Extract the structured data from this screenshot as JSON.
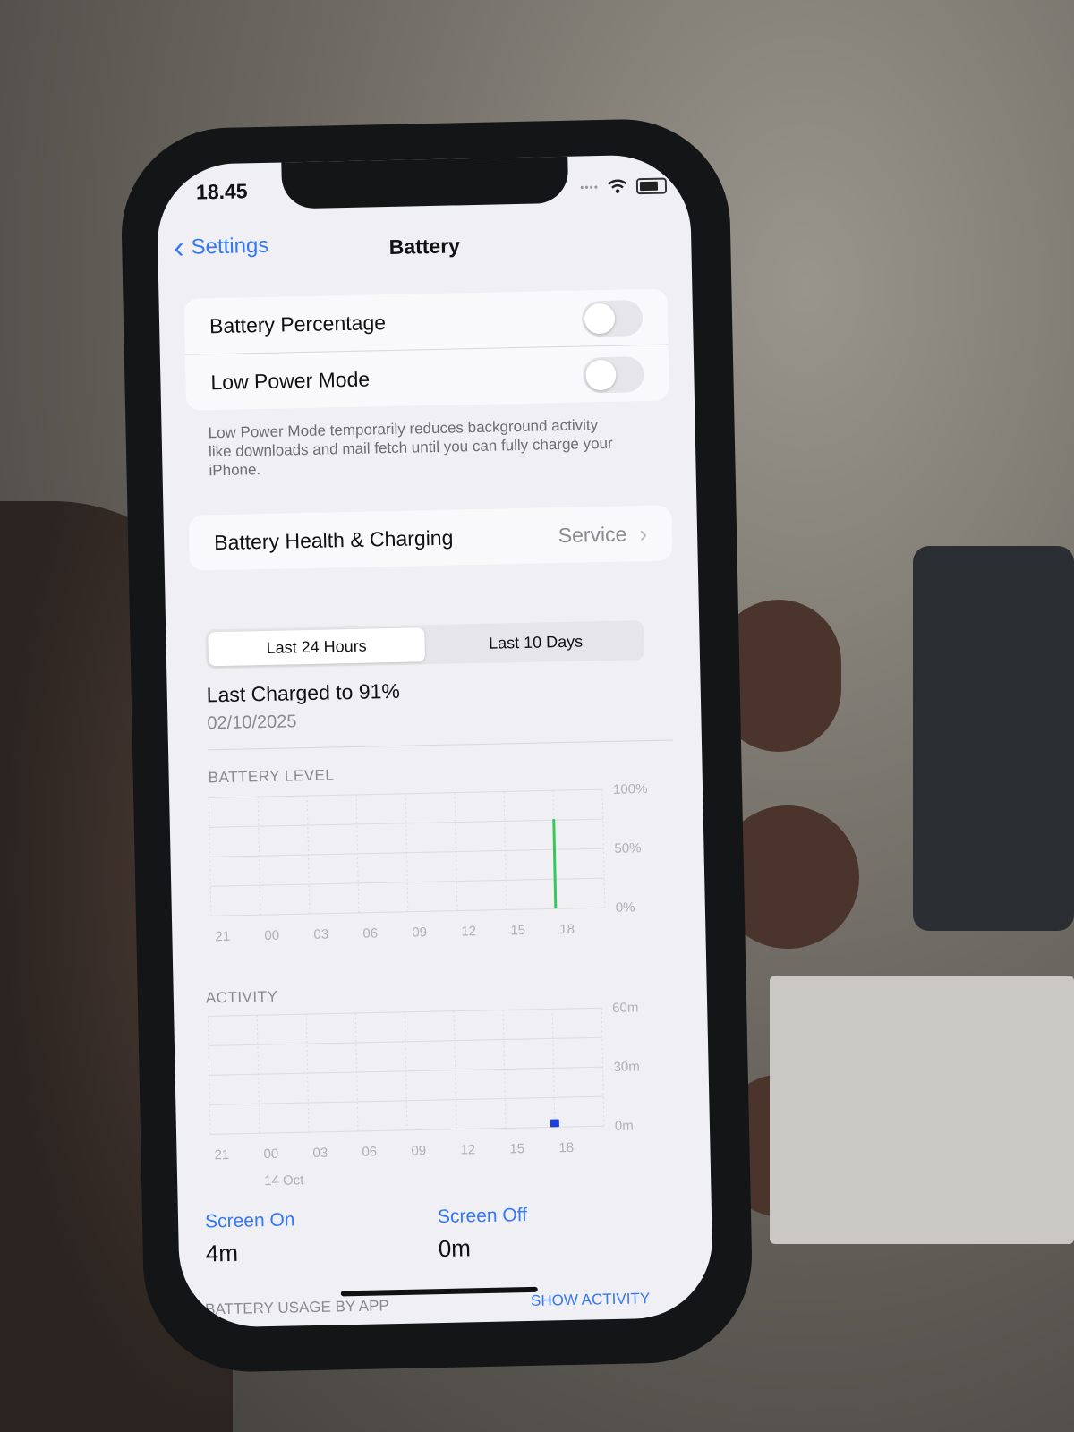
{
  "status_bar": {
    "time": "18.45"
  },
  "nav": {
    "back_label": "Settings",
    "title": "Battery"
  },
  "toggles": {
    "battery_percentage": {
      "label": "Battery Percentage",
      "on": false
    },
    "low_power_mode": {
      "label": "Low Power Mode",
      "on": false
    }
  },
  "low_power_note": "Low Power Mode temporarily reduces background activity like downloads and mail fetch until you can fully charge your iPhone.",
  "health": {
    "label": "Battery Health & Charging",
    "value": "Service"
  },
  "segments": {
    "tab_24h": "Last 24 Hours",
    "tab_10d": "Last 10 Days",
    "selected": "Last 10 Days"
  },
  "last_charged": {
    "title": "Last Charged to 91%",
    "date": "02/10/2025"
  },
  "battery_level_label": "BATTERY LEVEL",
  "activity_label": "ACTIVITY",
  "date_marker": "14 Oct",
  "chart_data": [
    {
      "type": "bar",
      "title": "BATTERY LEVEL",
      "categories": [
        "21",
        "00",
        "03",
        "06",
        "09",
        "12",
        "15",
        "18"
      ],
      "y_ticks": [
        "100%",
        "50%",
        "0%"
      ],
      "ylim": [
        0,
        100
      ],
      "bars": [
        {
          "x_hour": 18,
          "value": 76,
          "color": "#34c759"
        }
      ],
      "grid": true
    },
    {
      "type": "bar",
      "title": "ACTIVITY",
      "categories": [
        "21",
        "00",
        "03",
        "06",
        "09",
        "12",
        "15",
        "18"
      ],
      "y_ticks": [
        "60m",
        "30m",
        "0m"
      ],
      "ylim": [
        0,
        60
      ],
      "bars": [
        {
          "x_hour": 18,
          "value": 4,
          "color": "#1f3fd6"
        }
      ],
      "grid": true
    }
  ],
  "screen_on": {
    "label": "Screen On",
    "value": "4m"
  },
  "screen_off": {
    "label": "Screen Off",
    "value": "0m"
  },
  "usage": {
    "label": "BATTERY USAGE BY APP",
    "action": "SHOW ACTIVITY"
  }
}
